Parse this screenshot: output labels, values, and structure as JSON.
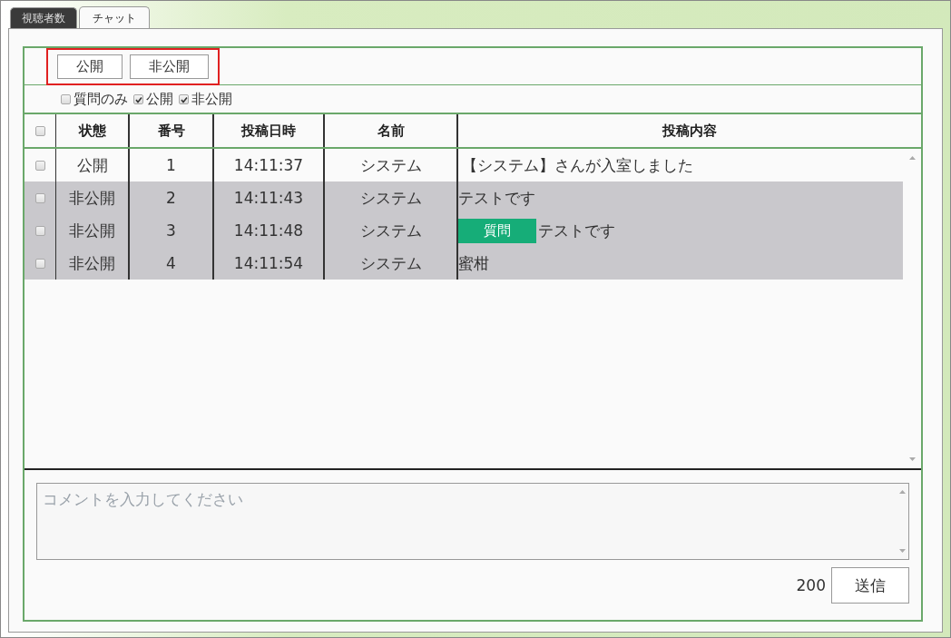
{
  "tabs": [
    {
      "label": "視聴者数",
      "selected": false
    },
    {
      "label": "チャット",
      "selected": true
    }
  ],
  "toolbar": {
    "buttons": [
      "公開",
      "非公開"
    ],
    "highlighted": true
  },
  "filters": [
    {
      "label": "質問のみ",
      "checked": false
    },
    {
      "label": "公開",
      "checked": true
    },
    {
      "label": "非公開",
      "checked": true
    }
  ],
  "table": {
    "select_all": {
      "checked": false
    },
    "columns": [
      "状態",
      "番号",
      "投稿日時",
      "名前",
      "投稿内容"
    ],
    "rows": [
      {
        "checked": false,
        "shaded": false,
        "status": "公開",
        "number": "1",
        "time": "14:11:37",
        "name": "システム",
        "content": "【システム】さんが入室しました"
      },
      {
        "checked": false,
        "shaded": true,
        "status": "非公開",
        "number": "2",
        "time": "14:11:43",
        "name": "システム",
        "content": "テストです"
      },
      {
        "checked": false,
        "shaded": true,
        "status": "非公開",
        "number": "3",
        "time": "14:11:48",
        "name": "システム",
        "tag": "質問",
        "content": "テストです"
      },
      {
        "checked": false,
        "shaded": true,
        "status": "非公開",
        "number": "4",
        "time": "14:11:54",
        "name": "システム",
        "content": "蜜柑"
      }
    ]
  },
  "compose": {
    "placeholder": "コメントを入力してください",
    "remaining": "200",
    "send_button": "送信"
  }
}
